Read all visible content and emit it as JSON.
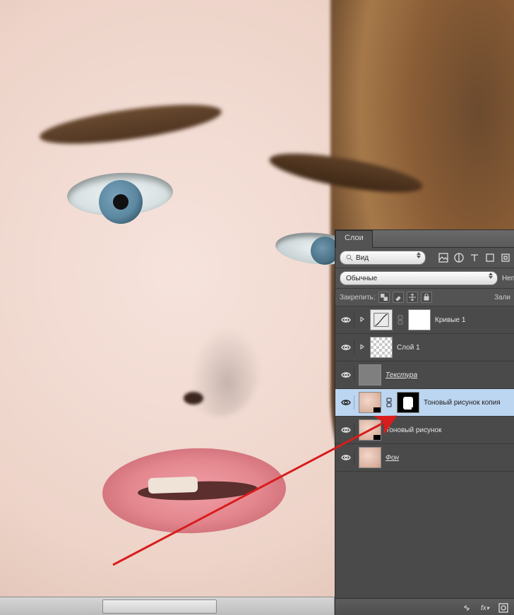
{
  "panel": {
    "tab_label": "Слои",
    "search": {
      "placeholder": "Вид",
      "icon_name": "search-icon"
    },
    "type_icons": [
      "image-filter-icon",
      "adjust-icon",
      "type-icon",
      "shape-icon",
      "smart-icon"
    ],
    "blend_mode": "Обычные",
    "opacity_label": "Непрозрачн",
    "lock_label": "Закрепить:",
    "fill_label": "Зали",
    "layers": [
      {
        "name": "Кривые 1",
        "visible": true,
        "kind": "adjustment",
        "selected": false,
        "clipped": true
      },
      {
        "name": "Слой 1",
        "visible": true,
        "kind": "transparent",
        "selected": false,
        "clipped": true
      },
      {
        "name": "Текстура",
        "visible": true,
        "kind": "gray",
        "selected": false,
        "underlined": true
      },
      {
        "name": "Тоновый рисунок копия",
        "visible": true,
        "kind": "photo-mask",
        "selected": true
      },
      {
        "name": "Тоновый рисунок",
        "visible": true,
        "kind": "photo",
        "selected": false
      },
      {
        "name": "Фон",
        "visible": true,
        "kind": "photo",
        "selected": false
      }
    ],
    "footer_icons": [
      "link-icon",
      "fx-icon",
      "mask-icon",
      "adjustment-icon",
      "group-icon",
      "new-layer-icon",
      "trash-icon"
    ]
  }
}
